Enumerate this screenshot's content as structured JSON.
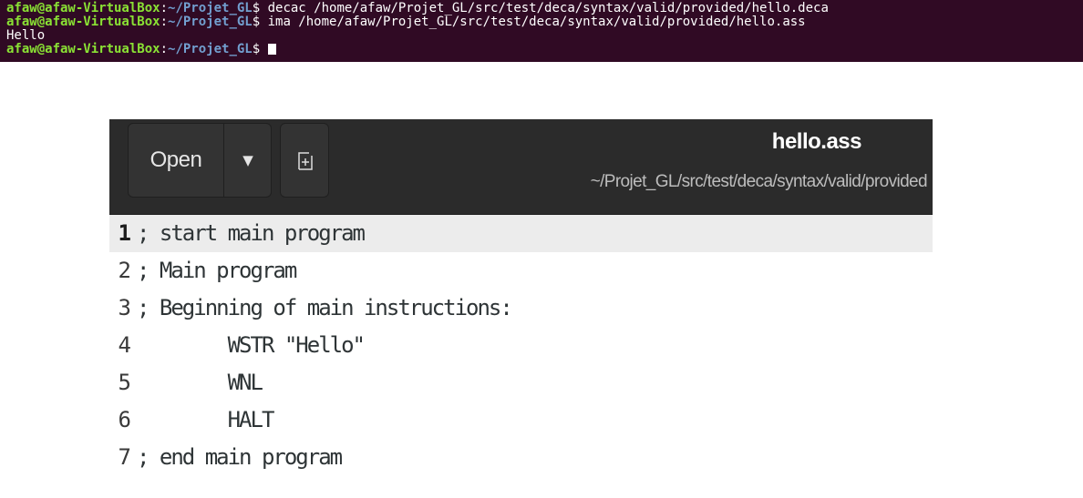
{
  "terminal": {
    "lines": [
      {
        "user": "afaw@afaw-VirtualBox",
        "sep": ":",
        "path": "~/Projet_GL",
        "prompt": "$ ",
        "cmd": "decac /home/afaw/Projet_GL/src/test/deca/syntax/valid/provided/hello.deca"
      },
      {
        "user": "afaw@afaw-VirtualBox",
        "sep": ":",
        "path": "~/Projet_GL",
        "prompt": "$ ",
        "cmd": "ima /home/afaw/Projet_GL/src/test/deca/syntax/valid/provided/hello.ass"
      },
      {
        "output": "Hello"
      },
      {
        "user": "afaw@afaw-VirtualBox",
        "sep": ":",
        "path": "~/Projet_GL",
        "prompt": "$ ",
        "cmd": ""
      }
    ]
  },
  "editor": {
    "open_label": "Open",
    "title": "hello.ass",
    "subtitle": "~/Projet_GL/src/test/deca/syntax/valid/provided",
    "lines": [
      {
        "num": "1",
        "text": "; start main program"
      },
      {
        "num": "2",
        "text": "; Main program"
      },
      {
        "num": "3",
        "text": "; Beginning of main instructions:"
      },
      {
        "num": "4",
        "text": "        WSTR \"Hello\""
      },
      {
        "num": "5",
        "text": "        WNL"
      },
      {
        "num": "6",
        "text": "        HALT"
      },
      {
        "num": "7",
        "text": "; end main program"
      }
    ]
  },
  "icons": {
    "dropdown": "chevron-down-icon",
    "new_document": "new-document-icon"
  }
}
